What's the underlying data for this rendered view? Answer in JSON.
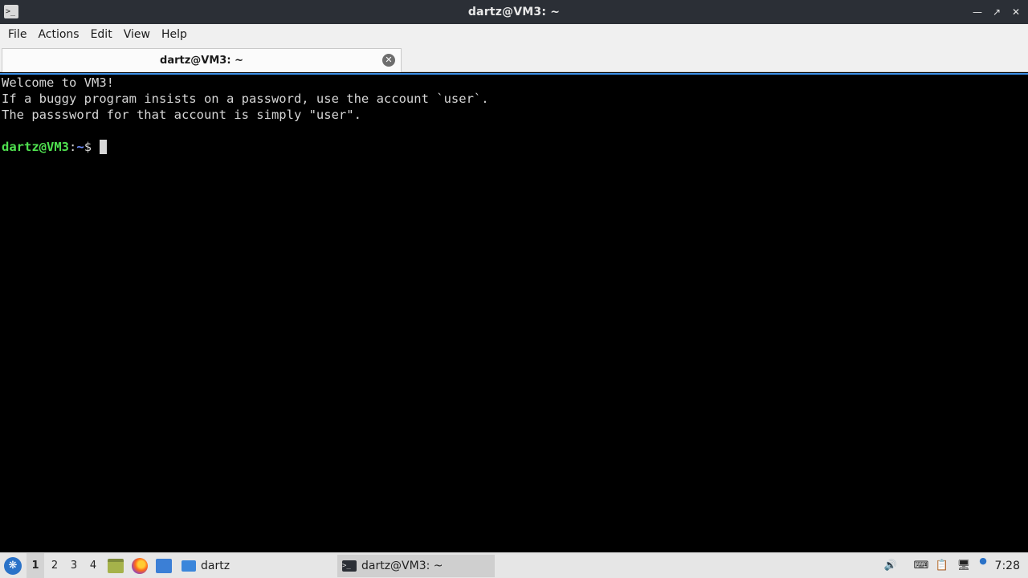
{
  "window": {
    "title": "dartz@VM3: ~",
    "app_icon": "terminal-icon",
    "controls": [
      "minimize-icon",
      "maximize-icon",
      "close-icon"
    ]
  },
  "menu": {
    "items": [
      "File",
      "Actions",
      "Edit",
      "View",
      "Help"
    ]
  },
  "tabs": [
    {
      "label": "dartz@VM3: ~",
      "close_icon": "close-circle-icon"
    }
  ],
  "terminal": {
    "lines": [
      "Welcome to VM3!",
      "If a buggy program insists on a password, use the account `user`.",
      "The passsword for that account is simply \"user\".",
      ""
    ],
    "prompt": {
      "user_host": "dartz@VM3",
      "separator": ":",
      "path": "~",
      "symbol": "$"
    },
    "colors": {
      "background": "#000000",
      "text": "#d6d6d6",
      "prompt_user": "#4fe04f",
      "prompt_path": "#6f8fff",
      "accent_border": "#3a8ee6"
    }
  },
  "taskbar": {
    "start_icon": "lxqt-start-icon",
    "workspaces": [
      "1",
      "2",
      "3",
      "4"
    ],
    "active_workspace": "1",
    "quick_launch": [
      "file-manager-icon",
      "firefox-icon",
      "show-desktop-icon"
    ],
    "tasks": [
      {
        "label": "dartz",
        "icon": "folder-icon",
        "active": false
      },
      {
        "label": "dartz@VM3: ~",
        "icon": "terminal-icon",
        "active": true
      }
    ],
    "tray": [
      "volume-icon",
      "keyboard-icon",
      "clipboard-icon",
      "network-icon",
      "update-notifier-icon"
    ],
    "clock": "7:28"
  }
}
